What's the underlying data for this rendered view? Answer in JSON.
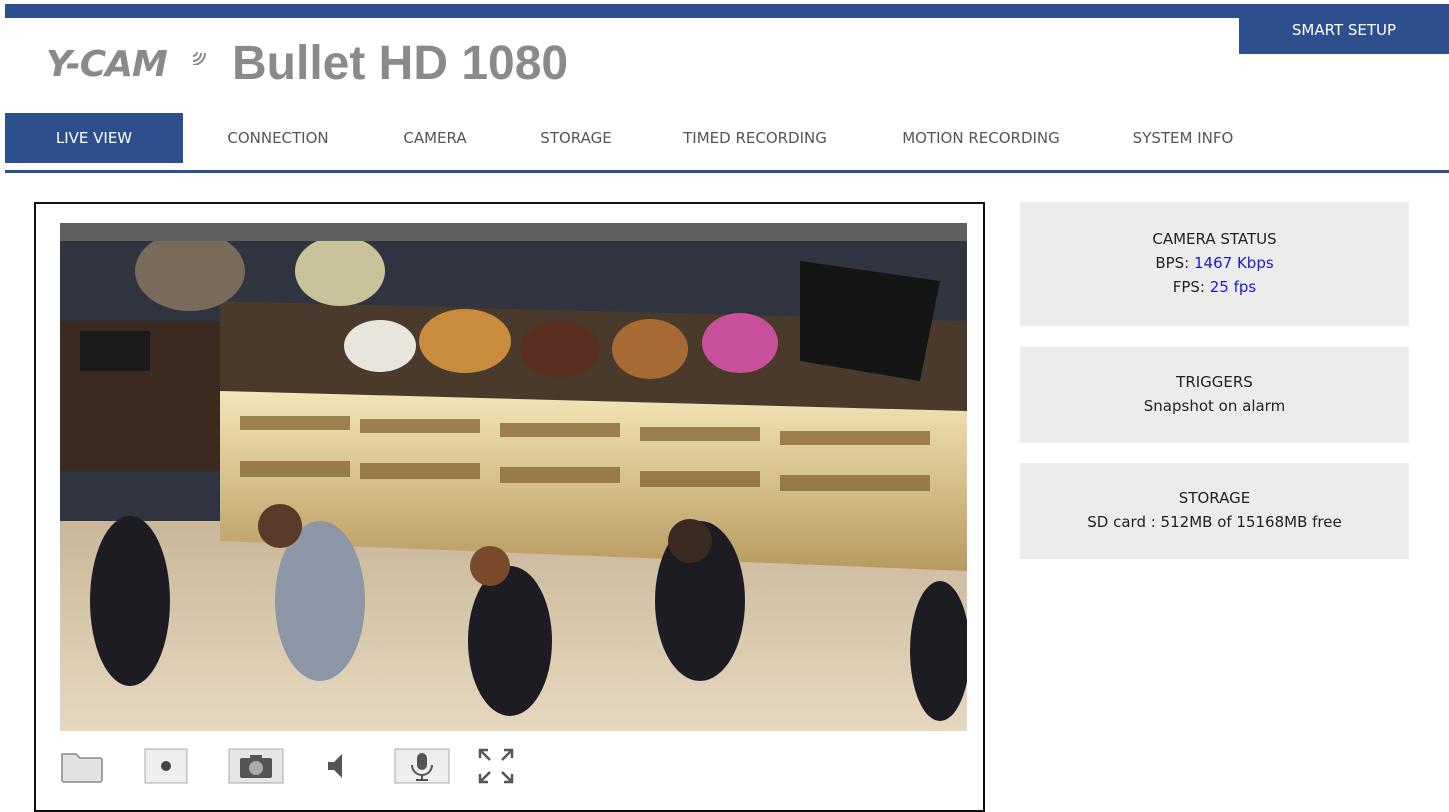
{
  "header": {
    "smart_setup_label": "SMART SETUP",
    "logo_text": "Y-CAM",
    "product_title": "Bullet HD 1080"
  },
  "nav": {
    "items": [
      {
        "label": "LIVE VIEW",
        "active": true
      },
      {
        "label": "CONNECTION",
        "active": false
      },
      {
        "label": "CAMERA",
        "active": false
      },
      {
        "label": "STORAGE",
        "active": false
      },
      {
        "label": "TIMED RECORDING",
        "active": false
      },
      {
        "label": "MOTION RECORDING",
        "active": false
      },
      {
        "label": "SYSTEM INFO",
        "active": false
      }
    ]
  },
  "video": {
    "controls": [
      "folder-icon",
      "record-icon",
      "snapshot-camera-icon",
      "speaker-icon",
      "microphone-icon",
      "fullscreen-icon"
    ]
  },
  "camera_status": {
    "heading": "CAMERA STATUS",
    "bps_label": "BPS: ",
    "bps_value": "1467 Kbps",
    "fps_label": "FPS: ",
    "fps_value": "25 fps"
  },
  "triggers": {
    "heading": "TRIGGERS",
    "text": "Snapshot on alarm"
  },
  "storage": {
    "heading": "STORAGE",
    "text": "SD card : 512MB of 15168MB free"
  },
  "colors": {
    "brand_blue": "#2d4f8e",
    "value_blue": "#1a1acc",
    "panel_gray": "#ececec"
  }
}
